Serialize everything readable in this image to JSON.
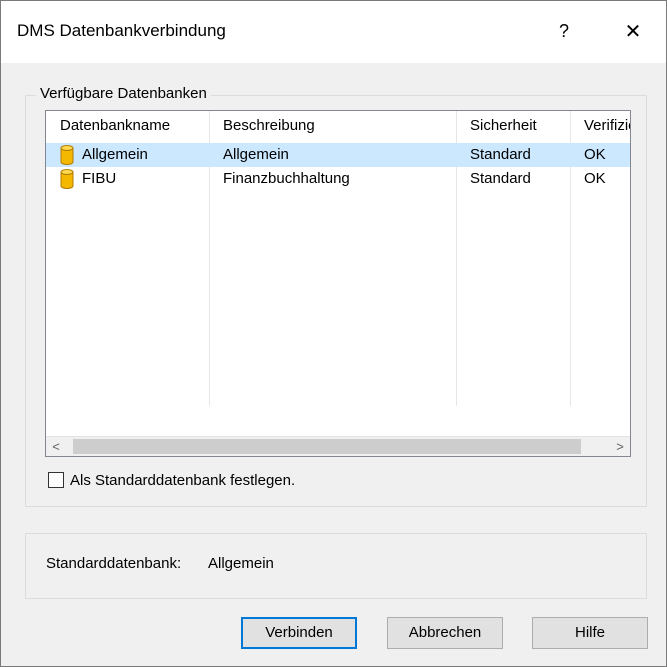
{
  "window": {
    "title": "DMS Datenbankverbindung",
    "help_glyph": "?",
    "close_glyph": "✕"
  },
  "group": {
    "legend": "Verfügbare Datenbanken"
  },
  "table": {
    "columns": [
      "Datenbankname",
      "Beschreibung",
      "Sicherheit",
      "Verifizie"
    ],
    "rows": [
      {
        "name": "Allgemein",
        "description": "Allgemein",
        "security": "Standard",
        "verified": "OK",
        "selected": true
      },
      {
        "name": "FIBU",
        "description": "Finanzbuchhaltung",
        "security": "Standard",
        "verified": "OK",
        "selected": false
      }
    ],
    "row_icon": "database-icon"
  },
  "scrollbar": {
    "left_arrow": "<",
    "right_arrow": ">"
  },
  "checkbox": {
    "label": "Als Standarddatenbank festlegen.",
    "checked": false
  },
  "info": {
    "label": "Standarddatenbank:",
    "value": "Allgemein"
  },
  "buttons": {
    "connect": "Verbinden",
    "cancel": "Abbrechen",
    "help": "Hilfe"
  },
  "colors": {
    "selection": "#cce8ff",
    "accent": "#0078d7",
    "icon_fill": "#f5b800"
  }
}
